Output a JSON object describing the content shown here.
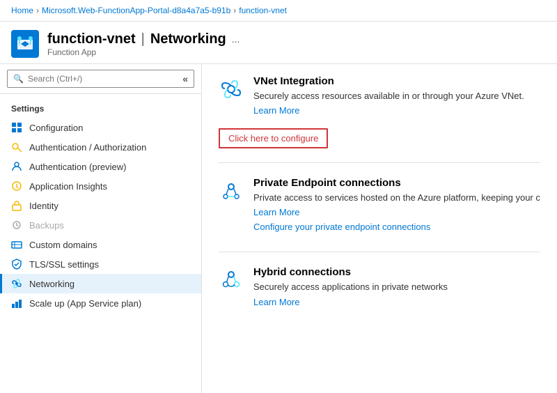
{
  "breadcrumb": {
    "home": "Home",
    "resource_group": "Microsoft.Web-FunctionApp-Portal-d8a4a7a5-b91b",
    "current": "function-vnet"
  },
  "header": {
    "title": "function-vnet",
    "separator": "|",
    "page": "Networking",
    "subtitle": "Function App",
    "more_options": "..."
  },
  "sidebar": {
    "search_placeholder": "Search (Ctrl+/)",
    "collapse_label": "«",
    "section_label": "Settings",
    "items": [
      {
        "id": "configuration",
        "label": "Configuration",
        "icon": "grid-icon"
      },
      {
        "id": "auth-authorization",
        "label": "Authentication / Authorization",
        "icon": "key-icon"
      },
      {
        "id": "auth-preview",
        "label": "Authentication (preview)",
        "icon": "person-icon"
      },
      {
        "id": "app-insights",
        "label": "Application Insights",
        "icon": "bulb-icon"
      },
      {
        "id": "identity",
        "label": "Identity",
        "icon": "key-icon2"
      },
      {
        "id": "backups",
        "label": "Backups",
        "icon": "backup-icon",
        "disabled": true
      },
      {
        "id": "custom-domains",
        "label": "Custom domains",
        "icon": "domain-icon"
      },
      {
        "id": "tls-ssl",
        "label": "TLS/SSL settings",
        "icon": "shield-icon"
      },
      {
        "id": "networking",
        "label": "Networking",
        "icon": "network-icon",
        "active": true
      },
      {
        "id": "scale-up",
        "label": "Scale up (App Service plan)",
        "icon": "scaleup-icon"
      }
    ]
  },
  "content": {
    "sections": [
      {
        "id": "vnet-integration",
        "title": "VNet Integration",
        "description": "Securely access resources available in or through your Azure VNet.",
        "learn_more": "Learn More",
        "configure_label": "Click here to configure",
        "configure_link": null,
        "icon": "vnet-icon"
      },
      {
        "id": "private-endpoint",
        "title": "Private Endpoint connections",
        "description": "Private access to services hosted on the Azure platform, keeping your c",
        "learn_more": "Learn More",
        "configure_label": null,
        "configure_link": "Configure your private endpoint connections",
        "icon": "endpoint-icon"
      },
      {
        "id": "hybrid-connections",
        "title": "Hybrid connections",
        "description": "Securely access applications in private networks",
        "learn_more": "Learn More",
        "configure_label": null,
        "configure_link": null,
        "icon": "hybrid-icon"
      }
    ]
  }
}
